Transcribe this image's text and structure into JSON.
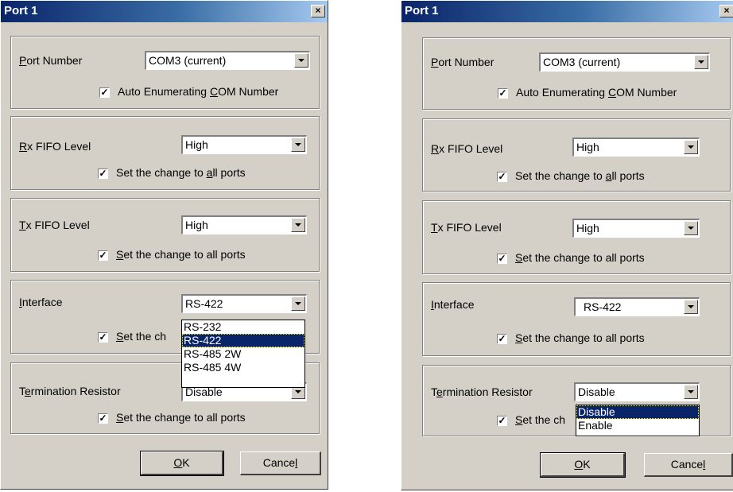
{
  "dialogs": {
    "left": {
      "title": "Port 1",
      "close": "×",
      "port_number": {
        "label_pre": "",
        "label_ul": "P",
        "label_post": "ort Number",
        "value": "COM3 (current)"
      },
      "auto_enum": {
        "checked": "✓",
        "pre": "Auto Enumerating ",
        "ul": "C",
        "post": "OM Number"
      },
      "rx": {
        "label_pre": "",
        "label_ul": "R",
        "label_post": "x FIFO Level",
        "value": "High",
        "check_pre": "Set the change to ",
        "check_ul": "a",
        "check_post": "ll ports"
      },
      "tx": {
        "label_pre": "",
        "label_ul": "T",
        "label_post": "x FIFO Level",
        "value": "High",
        "check_pre": "",
        "check_ul": "S",
        "check_post": "et the change to all ports"
      },
      "interface": {
        "label_pre": "",
        "label_ul": "I",
        "label_post": "nterface",
        "value": "RS-422",
        "check_pre": "",
        "check_ul": "S",
        "check_post": "et the ch",
        "options": [
          "RS-232",
          "RS-422",
          "RS-485 2W",
          "RS-485 4W"
        ],
        "selected": "RS-422"
      },
      "termination": {
        "label_pre": "T",
        "label_ul": "e",
        "label_post": "rmination Resistor",
        "value": "Disable",
        "check_pre": "",
        "check_ul": "S",
        "check_post": "et the change to all ports"
      },
      "ok": {
        "ul": "O",
        "post": "K"
      },
      "cancel": {
        "pre": "Cance",
        "ul": "l"
      }
    },
    "right": {
      "title": "Port 1",
      "close": "×",
      "port_number": {
        "label_pre": "",
        "label_ul": "P",
        "label_post": "ort Number",
        "value": "COM3 (current)"
      },
      "auto_enum": {
        "checked": "✓",
        "pre": "Auto Enumerating ",
        "ul": "C",
        "post": "OM Number"
      },
      "rx": {
        "label_pre": "",
        "label_ul": "R",
        "label_post": "x FIFO Level",
        "value": "High",
        "check_pre": "Set the change to ",
        "check_ul": "a",
        "check_post": "ll ports"
      },
      "tx": {
        "label_pre": "",
        "label_ul": "T",
        "label_post": "x FIFO Level",
        "value": "High",
        "check_pre": "",
        "check_ul": "S",
        "check_post": "et the change to all ports"
      },
      "interface": {
        "label_pre": "",
        "label_ul": "I",
        "label_post": "nterface",
        "value": "RS-422",
        "check_pre": "",
        "check_ul": "S",
        "check_post": "et the change to all ports"
      },
      "termination": {
        "label_pre": "T",
        "label_ul": "e",
        "label_post": "rmination Resistor",
        "value": "Disable",
        "check_pre": "",
        "check_ul": "S",
        "check_post": "et the ch",
        "options": [
          "Disable",
          "Enable"
        ],
        "selected": "Disable"
      },
      "ok": {
        "ul": "O",
        "post": "K"
      },
      "cancel": {
        "pre": "Cance",
        "ul": "l"
      }
    }
  },
  "colors": {
    "face": "#d4d0c8",
    "title_start": "#0a246a",
    "title_end": "#a6caf0",
    "highlight": "#0a246a"
  }
}
